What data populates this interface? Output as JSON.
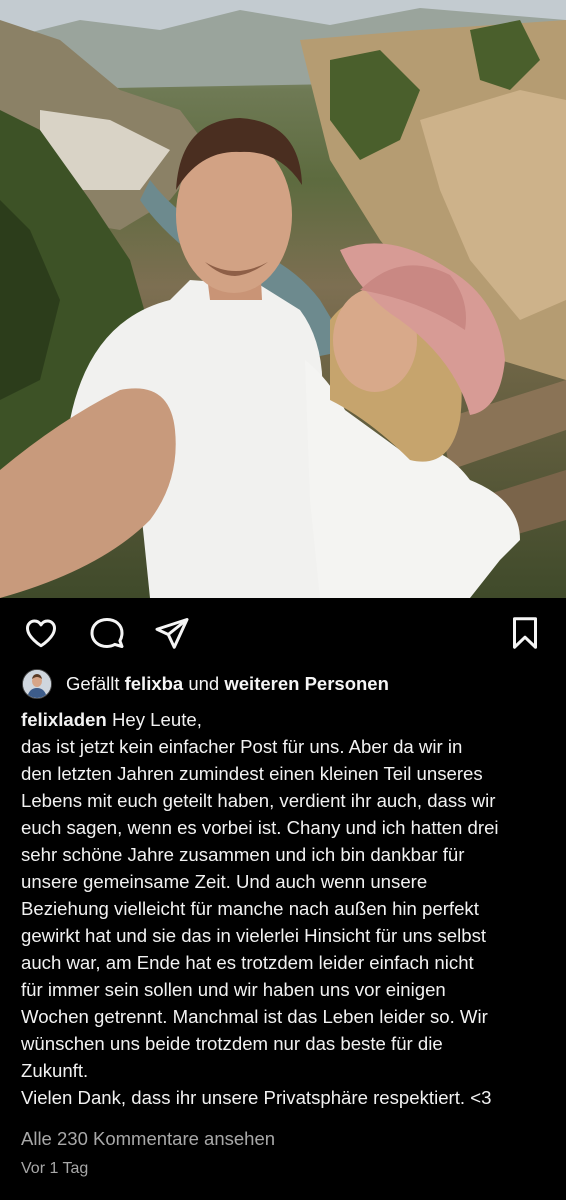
{
  "post": {
    "image_alt_icon": "photo-selfie-couple",
    "likes": {
      "prefix": "Gefällt",
      "user": "felixba",
      "connector": "und",
      "suffix": "weiteren Personen"
    },
    "caption": {
      "username": "felixladen",
      "lines": [
        "Hey Leute,",
        "das ist jetzt kein einfacher Post für uns. Aber da wir in",
        "den letzten Jahren zumindest einen kleinen Teil unseres",
        "Lebens mit euch geteilt haben, verdient ihr auch, dass wir",
        "euch sagen, wenn es vorbei ist. Chany und ich hatten drei",
        "sehr schöne Jahre zusammen und ich bin dankbar für",
        "unsere gemeinsame Zeit. Und auch wenn unsere",
        "Beziehung vielleicht für manche nach außen hin perfekt",
        "gewirkt hat und sie das in vielerlei Hinsicht für uns selbst",
        "auch war, am Ende hat es trotzdem leider einfach nicht",
        "für immer sein sollen und wir haben uns vor einigen",
        "Wochen getrennt. Manchmal ist das Leben leider so. Wir",
        "wünschen uns beide trotzdem nur das beste für die",
        "Zukunft.",
        "Vielen Dank, dass ihr unsere Privatsphäre respektiert. <3"
      ]
    },
    "view_comments": "Alle 230 Kommentare ansehen",
    "timestamp": "Vor 1 Tag"
  },
  "icons": {
    "like": "heart-icon",
    "comment": "comment-icon",
    "share": "send-icon",
    "save": "bookmark-icon"
  },
  "colors": {
    "background": "#000000",
    "text": "#f5f5f5",
    "muted": "#a8a8a8"
  }
}
